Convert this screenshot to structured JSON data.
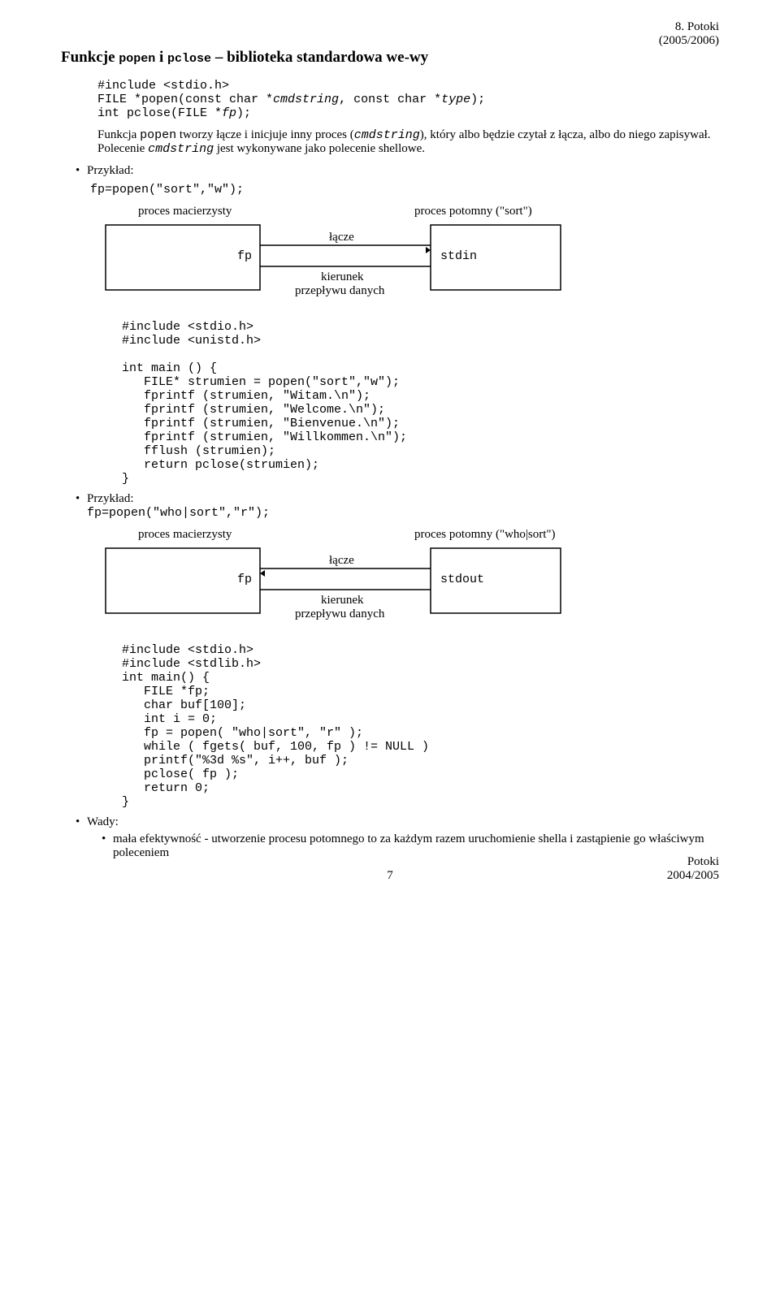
{
  "header": {
    "line1": "8. Potoki",
    "line2": "(2005/2006)"
  },
  "title_parts": {
    "t1": "Funkcje ",
    "t2": "popen",
    "t3": " i ",
    "t4": "pclose",
    "t5": " – biblioteka standardowa we-wy"
  },
  "proto": {
    "l1": "#include <stdio.h>",
    "l2a": "FILE *popen(const char *",
    "l2b": "cmdstring",
    "l2c": ", const char *",
    "l2d": "type",
    "l2e": ");",
    "l3a": "int pclose(FILE *",
    "l3b": "fp",
    "l3c": ");"
  },
  "body_para": {
    "p1": "Funkcja ",
    "p2": "popen",
    "p3": " tworzy łącze i inicjuje inny proces (",
    "p4": "cmdstring",
    "p5": "), który albo będzie czytał z łącza, albo do niego zapisywał. Polecenie ",
    "p6": "cmdstring",
    "p7": " jest wykonywane jako polecenie shellowe."
  },
  "bullet_ex": "Przykład:",
  "ex1_code": "fp=popen(\"sort\",\"w\");",
  "diagram1": {
    "left": "proces macierzysty",
    "right": "proces potomny (\"sort\")",
    "fp": "fp",
    "lacze": "łącze",
    "kierunek1": "kierunek",
    "kierunek2": "przepływu danych",
    "box_right": "stdin"
  },
  "code1": "#include <stdio.h>\n#include <unistd.h>\n\nint main () {\n   FILE* strumien = popen(\"sort\",\"w\");\n   fprintf (strumien, \"Witam.\\n\");\n   fprintf (strumien, \"Welcome.\\n\");\n   fprintf (strumien, \"Bienvenue.\\n\");\n   fprintf (strumien, \"Willkommen.\\n\");\n   fflush (strumien);\n   return pclose(strumien);\n}",
  "ex2_code": "fp=popen(\"who|sort\",\"r\");",
  "diagram2": {
    "left": "proces macierzysty",
    "right": "proces potomny (\"who|sort\")",
    "fp": "fp",
    "lacze": "łącze",
    "kierunek1": "kierunek",
    "kierunek2": "przepływu danych",
    "box_right": "stdout"
  },
  "code2": "#include <stdio.h>\n#include <stdlib.h>\nint main() {\n   FILE *fp;\n   char buf[100];\n   int i = 0;\n   fp = popen( \"who|sort\", \"r\" );\n   while ( fgets( buf, 100, fp ) != NULL )\n   printf(\"%3d %s\", i++, buf );\n   pclose( fp );\n   return 0;\n}",
  "wady_label": "Wady:",
  "wady_sub": "mała efektywność - utworzenie procesu potomnego to za każdym razem uruchomienie shella i zastąpienie go właściwym poleceniem",
  "footer": {
    "page": "7",
    "r1": "Potoki",
    "r2": "2004/2005"
  }
}
